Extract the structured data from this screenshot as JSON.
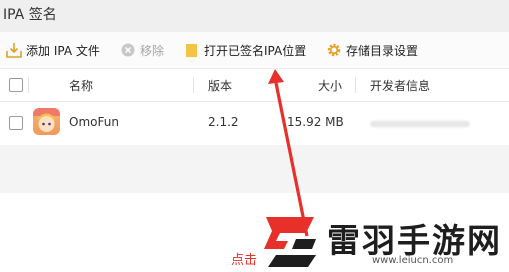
{
  "window": {
    "title": "IPA 签名"
  },
  "toolbar": {
    "add_label": "添加 IPA 文件",
    "remove_label": "移除",
    "open_label": "打开已签名IPA位置",
    "settings_label": "存储目录设置"
  },
  "table": {
    "columns": [
      "名称",
      "版本",
      "大小",
      "开发者信息"
    ],
    "rows": [
      {
        "name": "OmoFun",
        "version": "2.1.2",
        "size": "15.92 MB"
      }
    ]
  },
  "watermark": {
    "brand": "雷羽手游网",
    "url": "www.leiucn.com"
  },
  "annotation": {
    "click_text": "点击"
  },
  "colors": {
    "arrow": "#e8302a",
    "logo_red": "#e8302a",
    "folder": "#f3c444",
    "gear": "#e7a021"
  }
}
